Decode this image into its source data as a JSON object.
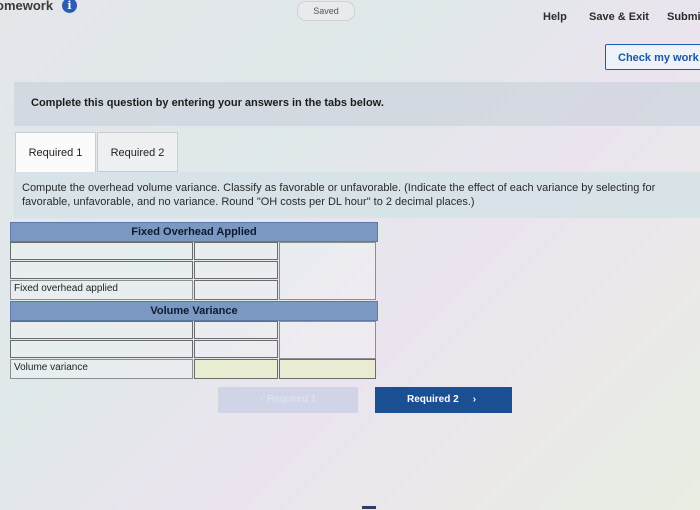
{
  "header": {
    "app_title": "omework",
    "info_icon": "info-icon",
    "saved_status": "Saved",
    "help_label": "Help",
    "save_exit_label": "Save & Exit",
    "submit_label": "Submi"
  },
  "check_work_label": "Check my work",
  "banner_text": "Complete this question by entering your answers in the tabs below.",
  "tabs": [
    {
      "label": "Required 1",
      "active": true
    },
    {
      "label": "Required 2",
      "active": false
    }
  ],
  "instructions": "Compute the overhead volume variance. Classify as favorable or unfavorable. (Indicate the effect of each variance by selecting for favorable, unfavorable, and no variance. Round \"OH costs per DL hour\" to 2 decimal places.)",
  "worksheet": {
    "section1_header": "Fixed Overhead Applied",
    "section1_total_label": "Fixed overhead applied",
    "section2_header": "Volume Variance",
    "section2_total_label": "Volume variance"
  },
  "nav": {
    "prev_label": "Required 1",
    "next_label": "Required 2",
    "prev_icon": "chevron-left-icon",
    "next_icon": "chevron-right-icon"
  }
}
